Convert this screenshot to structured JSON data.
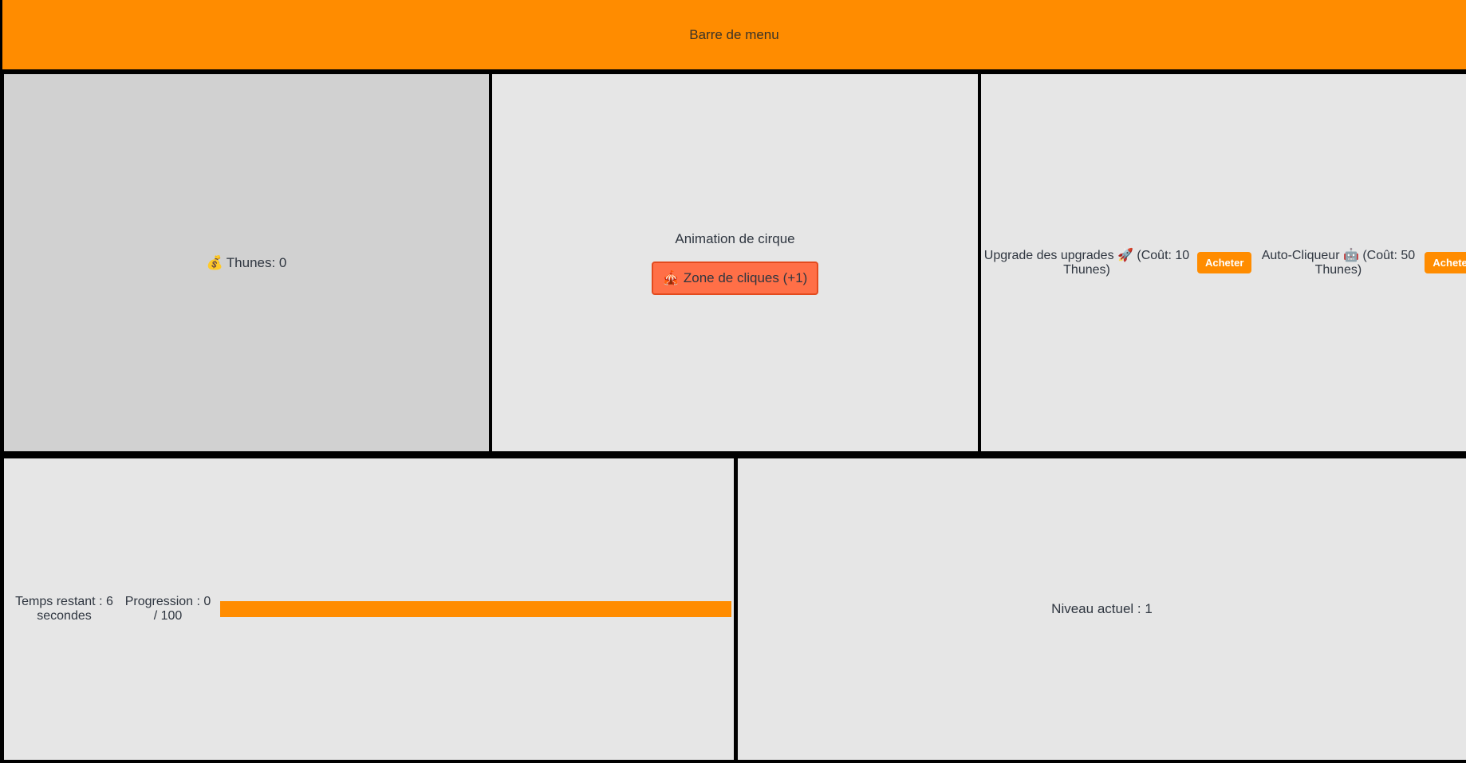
{
  "menubar": {
    "label": "Barre de menu"
  },
  "money": {
    "icon": "money-bag-icon",
    "icon_glyph": "💰",
    "label": "Thunes: 0",
    "value": 0
  },
  "animation": {
    "title": "Animation de cirque",
    "click_button": {
      "icon": "circus-tent-icon",
      "icon_glyph": "🎪",
      "label": "Zone de cliques (+1)"
    }
  },
  "shop": {
    "upgrades": [
      {
        "text": "Upgrade des upgrades 🚀 (Coût: 10 Thunes)",
        "button": "Acheter"
      },
      {
        "text": "Auto-Cliqueur 🤖 (Coût: 50 Thunes)",
        "button": "Acheter"
      }
    ]
  },
  "timer": {
    "remaining": "Temps restant : 6 secondes",
    "progress_label": "Progression : 0 / 100",
    "progress_value": 0,
    "progress_max": 100
  },
  "level": {
    "label": "Niveau actuel : 1"
  },
  "colors": {
    "accent": "#ff8c00",
    "click_button": "#ff6f47",
    "panel": "#e6e6e6",
    "panel_dark": "#d1d1d1"
  }
}
